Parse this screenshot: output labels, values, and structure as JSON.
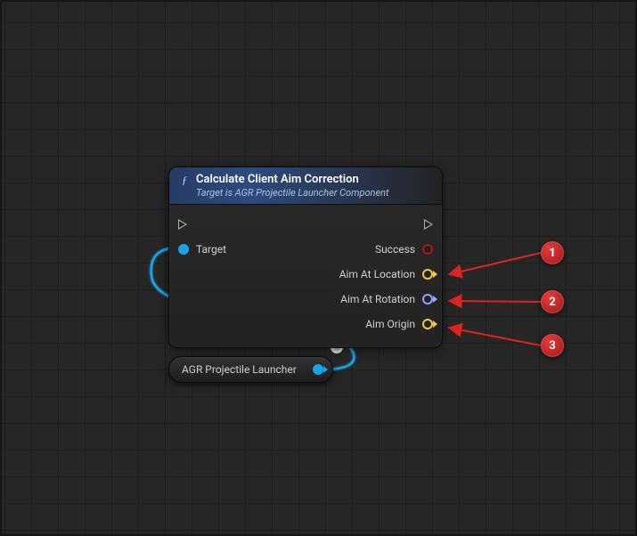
{
  "node": {
    "title": "Calculate Client Aim Correction",
    "subtitle": "Target is AGR Projectile Launcher Component",
    "inputs": {
      "target_label": "Target"
    },
    "outputs": {
      "success_label": "Success",
      "aim_at_location_label": "Aim At Location",
      "aim_at_rotation_label": "Aim At Rotation",
      "aim_origin_label": "Aim Origin"
    }
  },
  "variable": {
    "label": "AGR Projectile Launcher"
  },
  "pin_colors": {
    "object": "#1aa3e8",
    "bool": "#b01515",
    "vector": "#f2c94c",
    "rotator": "#8aa6ff"
  },
  "callouts": {
    "one": "1",
    "two": "2",
    "three": "3"
  }
}
